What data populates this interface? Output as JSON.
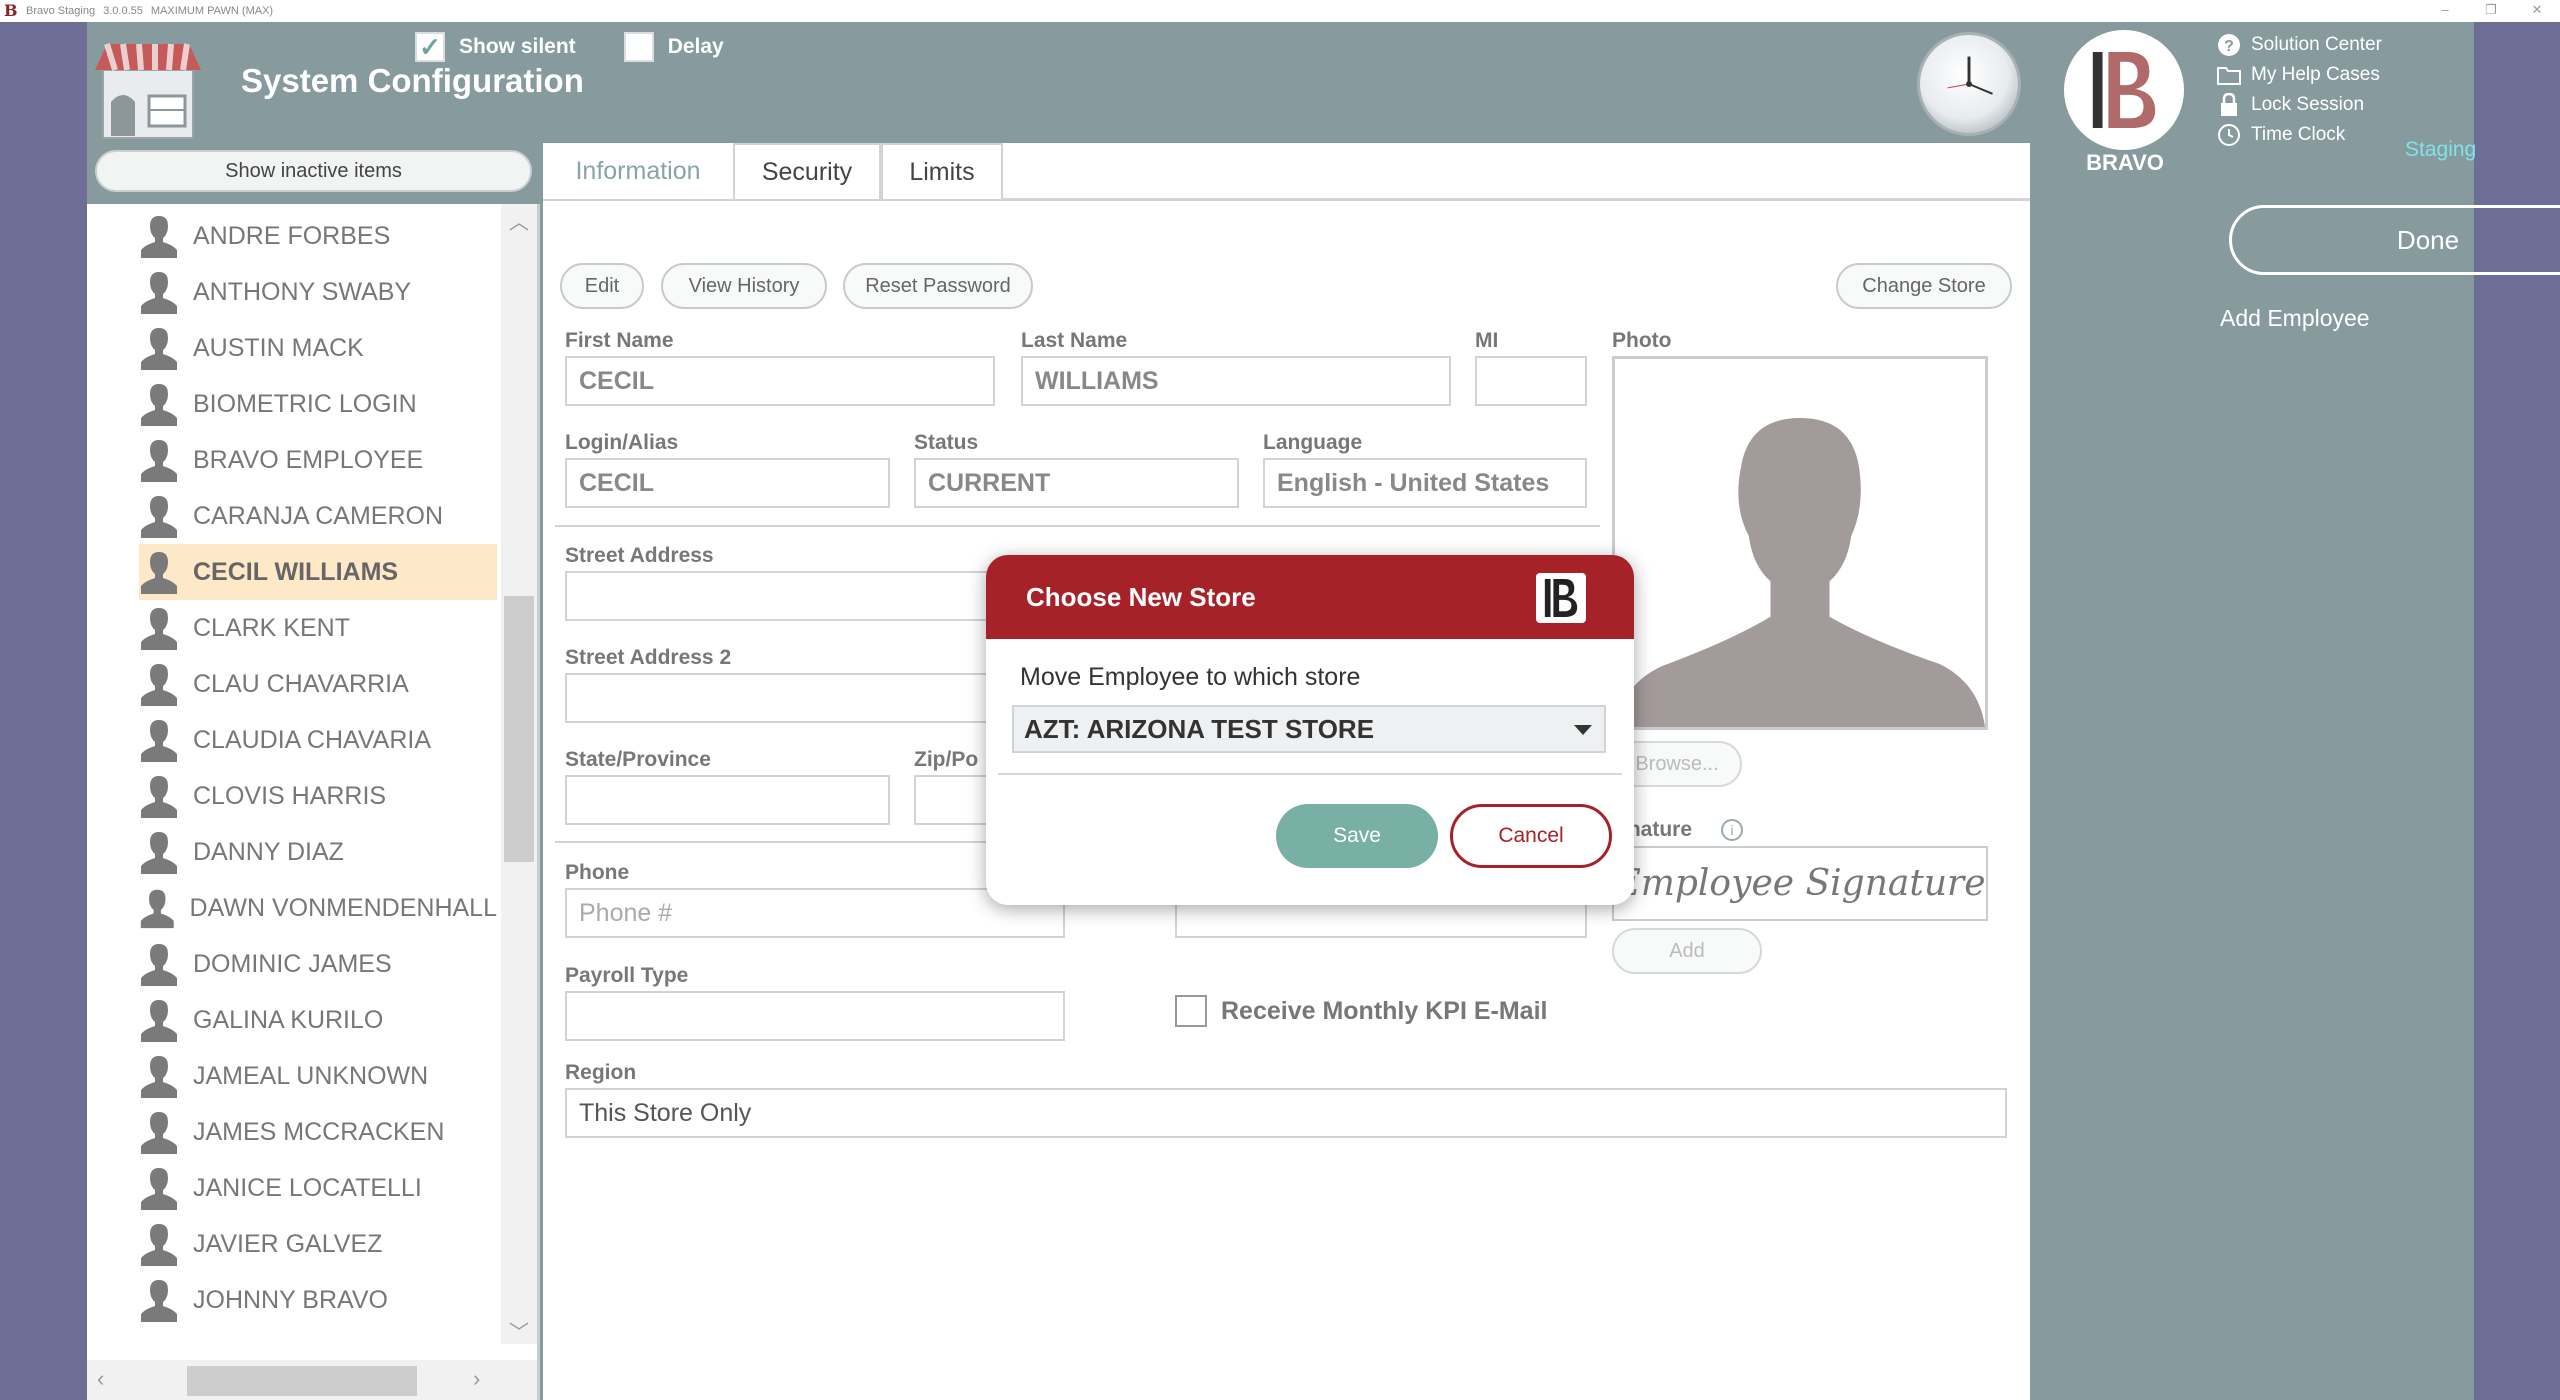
{
  "titlebar": {
    "app_name": "Bravo Staging",
    "version": "3.0.0.55",
    "company": "MAXIMUM PAWN (MAX)",
    "minimize": "–",
    "restore": "❐",
    "close": "✕"
  },
  "header": {
    "title": "System Configuration",
    "show_silent_label": "Show silent",
    "show_silent_checked": true,
    "delay_label": "Delay",
    "delay_checked": false,
    "brand_name": "BRAVO",
    "staging_label": "Staging"
  },
  "top_links": [
    {
      "label": "Solution Center",
      "icon": "question-circle-icon"
    },
    {
      "label": "My Help Cases",
      "icon": "folder-icon"
    },
    {
      "label": "Lock Session",
      "icon": "lock-icon"
    },
    {
      "label": "Time Clock",
      "icon": "clock-icon"
    }
  ],
  "right_panel": {
    "done_label": "Done",
    "add_employee_label": "Add Employee"
  },
  "sidebar": {
    "show_inactive_label": "Show inactive items",
    "employees": [
      "ANDRE FORBES",
      "ANTHONY SWABY",
      "AUSTIN MACK",
      "BIOMETRIC LOGIN",
      "BRAVO EMPLOYEE",
      "CARANJA CAMERON",
      "CECIL WILLIAMS",
      "CLARK KENT",
      "CLAU CHAVARRIA",
      "CLAUDIA CHAVARIA",
      "CLOVIS HARRIS",
      "DANNY DIAZ",
      "DAWN VONMENDENHALL",
      "DOMINIC JAMES",
      "GALINA KURILO",
      "JAMEAL UNKNOWN",
      "JAMES MCCRACKEN",
      "JANICE LOCATELLI",
      "JAVIER GALVEZ",
      "JOHNNY BRAVO"
    ],
    "selected_employee": "CECIL WILLIAMS"
  },
  "tabs": [
    {
      "label": "Information",
      "active": true
    },
    {
      "label": "Security",
      "active": false
    },
    {
      "label": "Limits",
      "active": false
    }
  ],
  "actions": {
    "edit": "Edit",
    "view_history": "View History",
    "reset_password": "Reset Password",
    "change_store": "Change Store"
  },
  "form": {
    "first_name_label": "First Name",
    "first_name": "CECIL",
    "last_name_label": "Last Name",
    "last_name": "WILLIAMS",
    "mi_label": "MI",
    "mi": "",
    "photo_label": "Photo",
    "login_label": "Login/Alias",
    "login": "CECIL",
    "status_label": "Status",
    "status": "CURRENT",
    "language_label": "Language",
    "language": "English - United States",
    "street_label": "Street Address",
    "street2_label": "Street Address 2",
    "state_label": "State/Province",
    "zip_label": "Zip/Po",
    "browse_label": "Browse...",
    "signature_label": "gnature",
    "signature_text": "Employee Signature",
    "add_label": "Add",
    "phone_label": "Phone",
    "phone_placeholder": "Phone #",
    "payroll_label": "Payroll Type",
    "kpi_label": "Receive Monthly KPI E-Mail",
    "region_label": "Region",
    "region": "This Store Only"
  },
  "dialog": {
    "title": "Choose New Store",
    "prompt": "Move Employee to which store",
    "selected_store": "AZT: ARIZONA TEST STORE",
    "save_label": "Save",
    "cancel_label": "Cancel"
  },
  "colors": {
    "header_bg": "#879a9d",
    "dialog_header": "#a52229",
    "save_button": "#78b0a6",
    "selected_row": "#fde9c8",
    "staging_text": "#7fe3e8"
  }
}
